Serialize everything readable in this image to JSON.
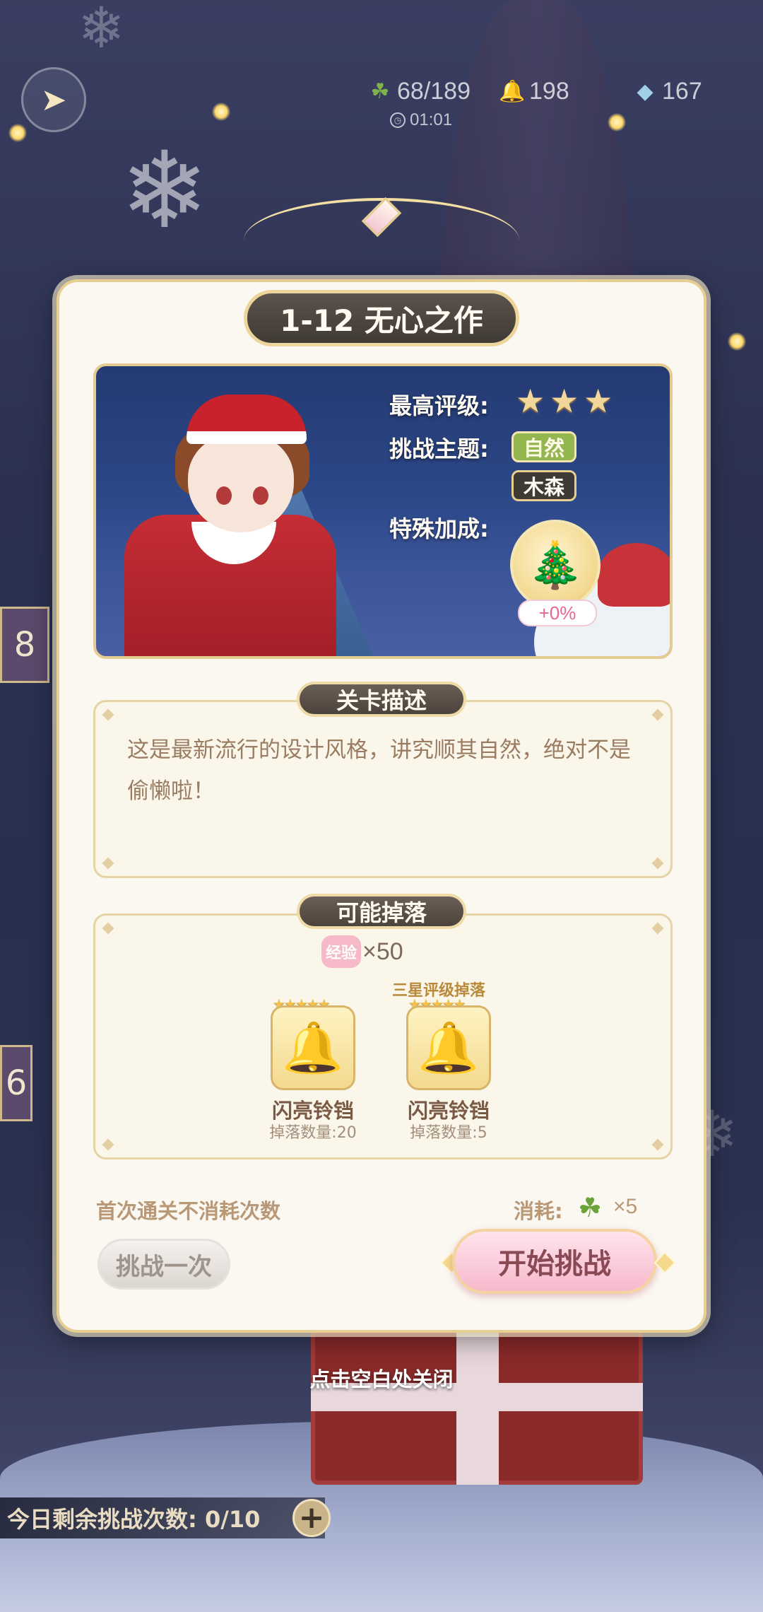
{
  "hud": {
    "clover": "68/189",
    "bell": "198",
    "gem": "167",
    "timer": "01:01"
  },
  "stage": {
    "title": "1-12 无心之作",
    "best_rating_label": "最高评级:",
    "best_rating_stars": 3,
    "theme_label": "挑战主题:",
    "theme_tags": [
      "自然",
      "木森"
    ],
    "bonus_label": "特殊加成:",
    "bonus_value": "+0%"
  },
  "description": {
    "title": "关卡描述",
    "text": "这是最新流行的设计风格，讲究顺其自然，绝对不是偷懒啦！"
  },
  "drops": {
    "title": "可能掉落",
    "exp_chip": "经验",
    "exp_amount": "×50",
    "three_star_note": "三星评级掉落",
    "items": [
      {
        "name": "闪亮铃铛",
        "count": "掉落数量:20",
        "icon": "bell-icon"
      },
      {
        "name": "闪亮铃铛",
        "count": "掉落数量:5",
        "icon": "bell-icon"
      }
    ]
  },
  "footer": {
    "first_clear": "首次通关不消耗次数",
    "cost_label": "消耗:",
    "cost_amount": "×5",
    "btn_once": "挑战一次",
    "btn_start": "开始挑战"
  },
  "close_hint": "点击空白处关闭",
  "daily": {
    "label": "今日剩余挑战次数: 0/10"
  },
  "side_tabs": [
    "8",
    "6"
  ],
  "colors": {
    "accent_gold": "#e7cf92",
    "start_button": "#f7b9cc",
    "nature_tag": "#93b64e"
  }
}
